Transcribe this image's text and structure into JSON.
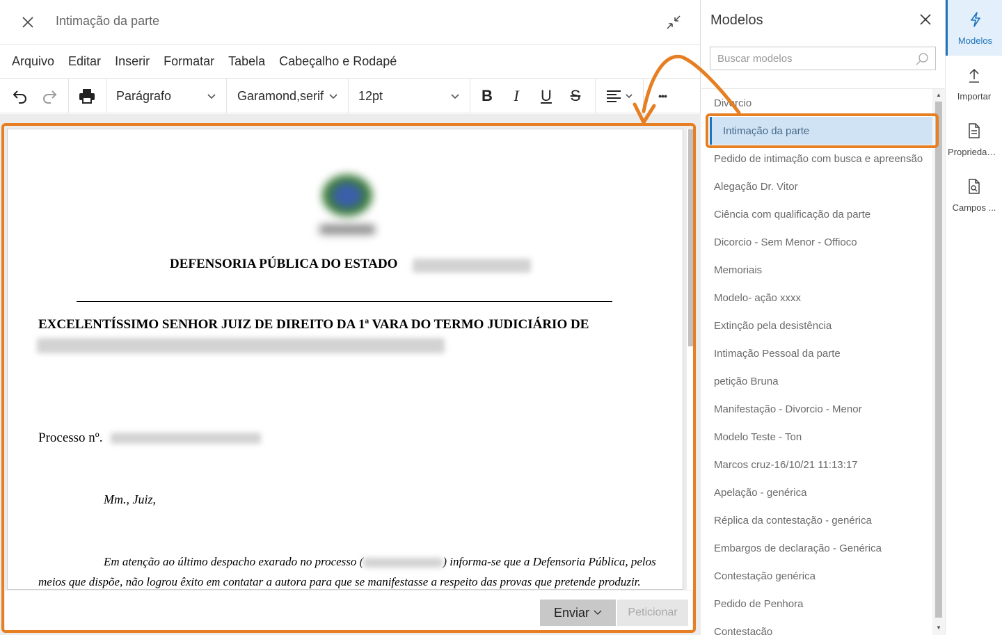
{
  "window": {
    "title": "Intimação da parte"
  },
  "menu": [
    "Arquivo",
    "Editar",
    "Inserir",
    "Formatar",
    "Tabela",
    "Cabeçalho e Rodapé"
  ],
  "toolbar": {
    "block_format": "Parágrafo",
    "font_family": "Garamond,serif",
    "font_size": "12pt",
    "bold_label": "B",
    "italic_label": "I",
    "underline_label": "U",
    "strike_label": "S",
    "more_label": "•••"
  },
  "document": {
    "heading": "DEFENSORIA PÚBLICA DO ESTADO",
    "addressee": "EXCELENTÍSSIMO SENHOR JUIZ DE DIREITO DA 1ª VARA DO TERMO JUDICIÁRIO DE",
    "process_label": "Processo nº.",
    "greeting": "Mm., Juiz,",
    "body_line1_start": "Em atenção ao último despacho exarado no processo (",
    "body_line1_end": ") informa-se que a Defensoria Pública, pelos",
    "body_line2": "meios que dispõe, não logrou êxito em contatar a autora para que se manifestasse a respeito das provas que pretende produzir."
  },
  "footer": {
    "send_label": "Enviar",
    "petition_label": "Peticionar"
  },
  "models_panel": {
    "title": "Modelos",
    "search_placeholder": "Buscar modelos",
    "items": [
      "Divorcio",
      "Intimação da parte",
      "Pedido de intimação com busca e apreensão",
      "Alegação Dr. Vitor",
      "Ciência com qualificação da parte",
      "Dicorcio - Sem Menor - Offioco",
      "Memoriais",
      "Modelo- ação xxxx",
      "Extinção pela desistência",
      "Intimação Pessoal da parte",
      "petição Bruna",
      "Manifestação - Divorcio - Menor",
      "Modelo Teste - Ton",
      "Marcos cruz-16/10/21 11:13:17",
      "Apelação - genérica",
      "Réplica da contestação - genérica",
      "Embargos de declaração - Genérica",
      "Contestação genérica",
      "Pedido de Penhora",
      "Contestação"
    ],
    "selected_index": 1
  },
  "rail": [
    {
      "label": "Modelos",
      "icon": "lightning-icon",
      "active": true
    },
    {
      "label": "Importar",
      "icon": "upload-icon",
      "active": false
    },
    {
      "label": "Propriedades",
      "icon": "document-properties-icon",
      "active": false
    },
    {
      "label": "Campos ...",
      "icon": "document-search-icon",
      "active": false
    }
  ],
  "colors": {
    "highlight": "#e67e22",
    "accent": "#1e73be",
    "selected_bg": "#cfe3f5"
  }
}
